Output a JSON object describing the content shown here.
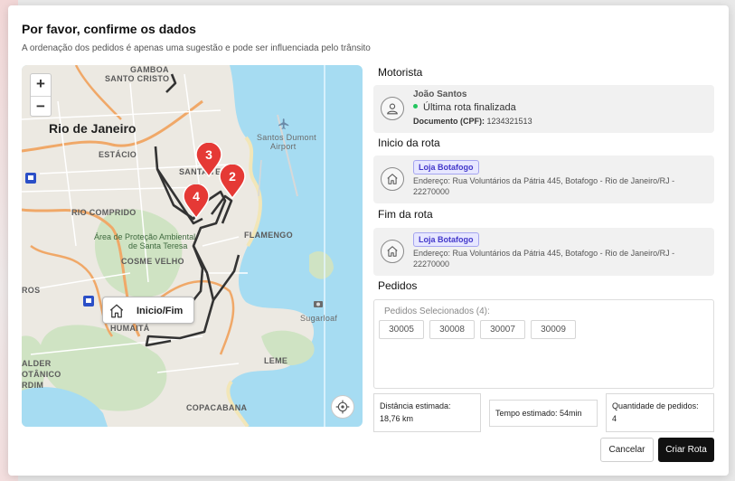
{
  "modal": {
    "title": "Por favor, confirme os dados",
    "subtitle": "A ordenação dos pedidos é apenas uma sugestão e pode ser influenciada pelo trânsito"
  },
  "map": {
    "zoom_in": "+",
    "zoom_out": "−",
    "labels": {
      "rio": "Rio de Janeiro",
      "gamboa": "GAMBOA",
      "santo_cristo": "SANTO CRISTO",
      "estacio": "ESTÁCIO",
      "santa_teresa": "SANTA TERESA",
      "rio_comprido": "RIO COMPRIDO",
      "area_prot_1": "Área de Proteção Ambiental",
      "area_prot_2": "de Santa Teresa",
      "cosme_velho": "COSME VELHO",
      "flamengo": "FLAMENGO",
      "santos_dumont_1": "Santos Dumont",
      "santos_dumont_2": "Airport",
      "sugarloaf": "Sugarloaf",
      "leme": "LEME",
      "copacabana": "COPACABANA",
      "humaita": "HUMAITÁ",
      "alder": "ALDER",
      "botanico": "OTÂNICO",
      "rdim": "RDIM",
      "ros": "ROS"
    },
    "pins": [
      "3",
      "2",
      "4"
    ],
    "start_end_label": "Inicio/Fim"
  },
  "driver": {
    "section": "Motorista",
    "name": "João Santos",
    "status": "Última rota finalizada",
    "doc_label": "Documento (CPF):",
    "doc_value": "1234321513"
  },
  "start": {
    "section": "Inicio da rota",
    "store": "Loja Botafogo",
    "address": "Endereço: Rua Voluntários da Pátria 445, Botafogo - Rio de Janeiro/RJ - 22270000"
  },
  "end": {
    "section": "Fim da rota",
    "store": "Loja Botafogo",
    "address": "Endereço: Rua Voluntários da Pátria 445, Botafogo - Rio de Janeiro/RJ - 22270000"
  },
  "orders": {
    "section": "Pedidos",
    "header": "Pedidos Selecionados (4):",
    "items": [
      "30005",
      "30008",
      "30007",
      "30009"
    ]
  },
  "stats": {
    "distance_label": "Distância estimada:",
    "distance_value": "18,76 km",
    "time": "Tempo estimado: 54min",
    "count_label": "Quantidade de pedidos:",
    "count_value": "4"
  },
  "buttons": {
    "cancel": "Cancelar",
    "create": "Criar Rota"
  },
  "colors": {
    "pin": "#e53935",
    "route": "#333333",
    "primary_button": "#111111",
    "status_dot": "#22c55e",
    "badge": "#4338ca"
  }
}
